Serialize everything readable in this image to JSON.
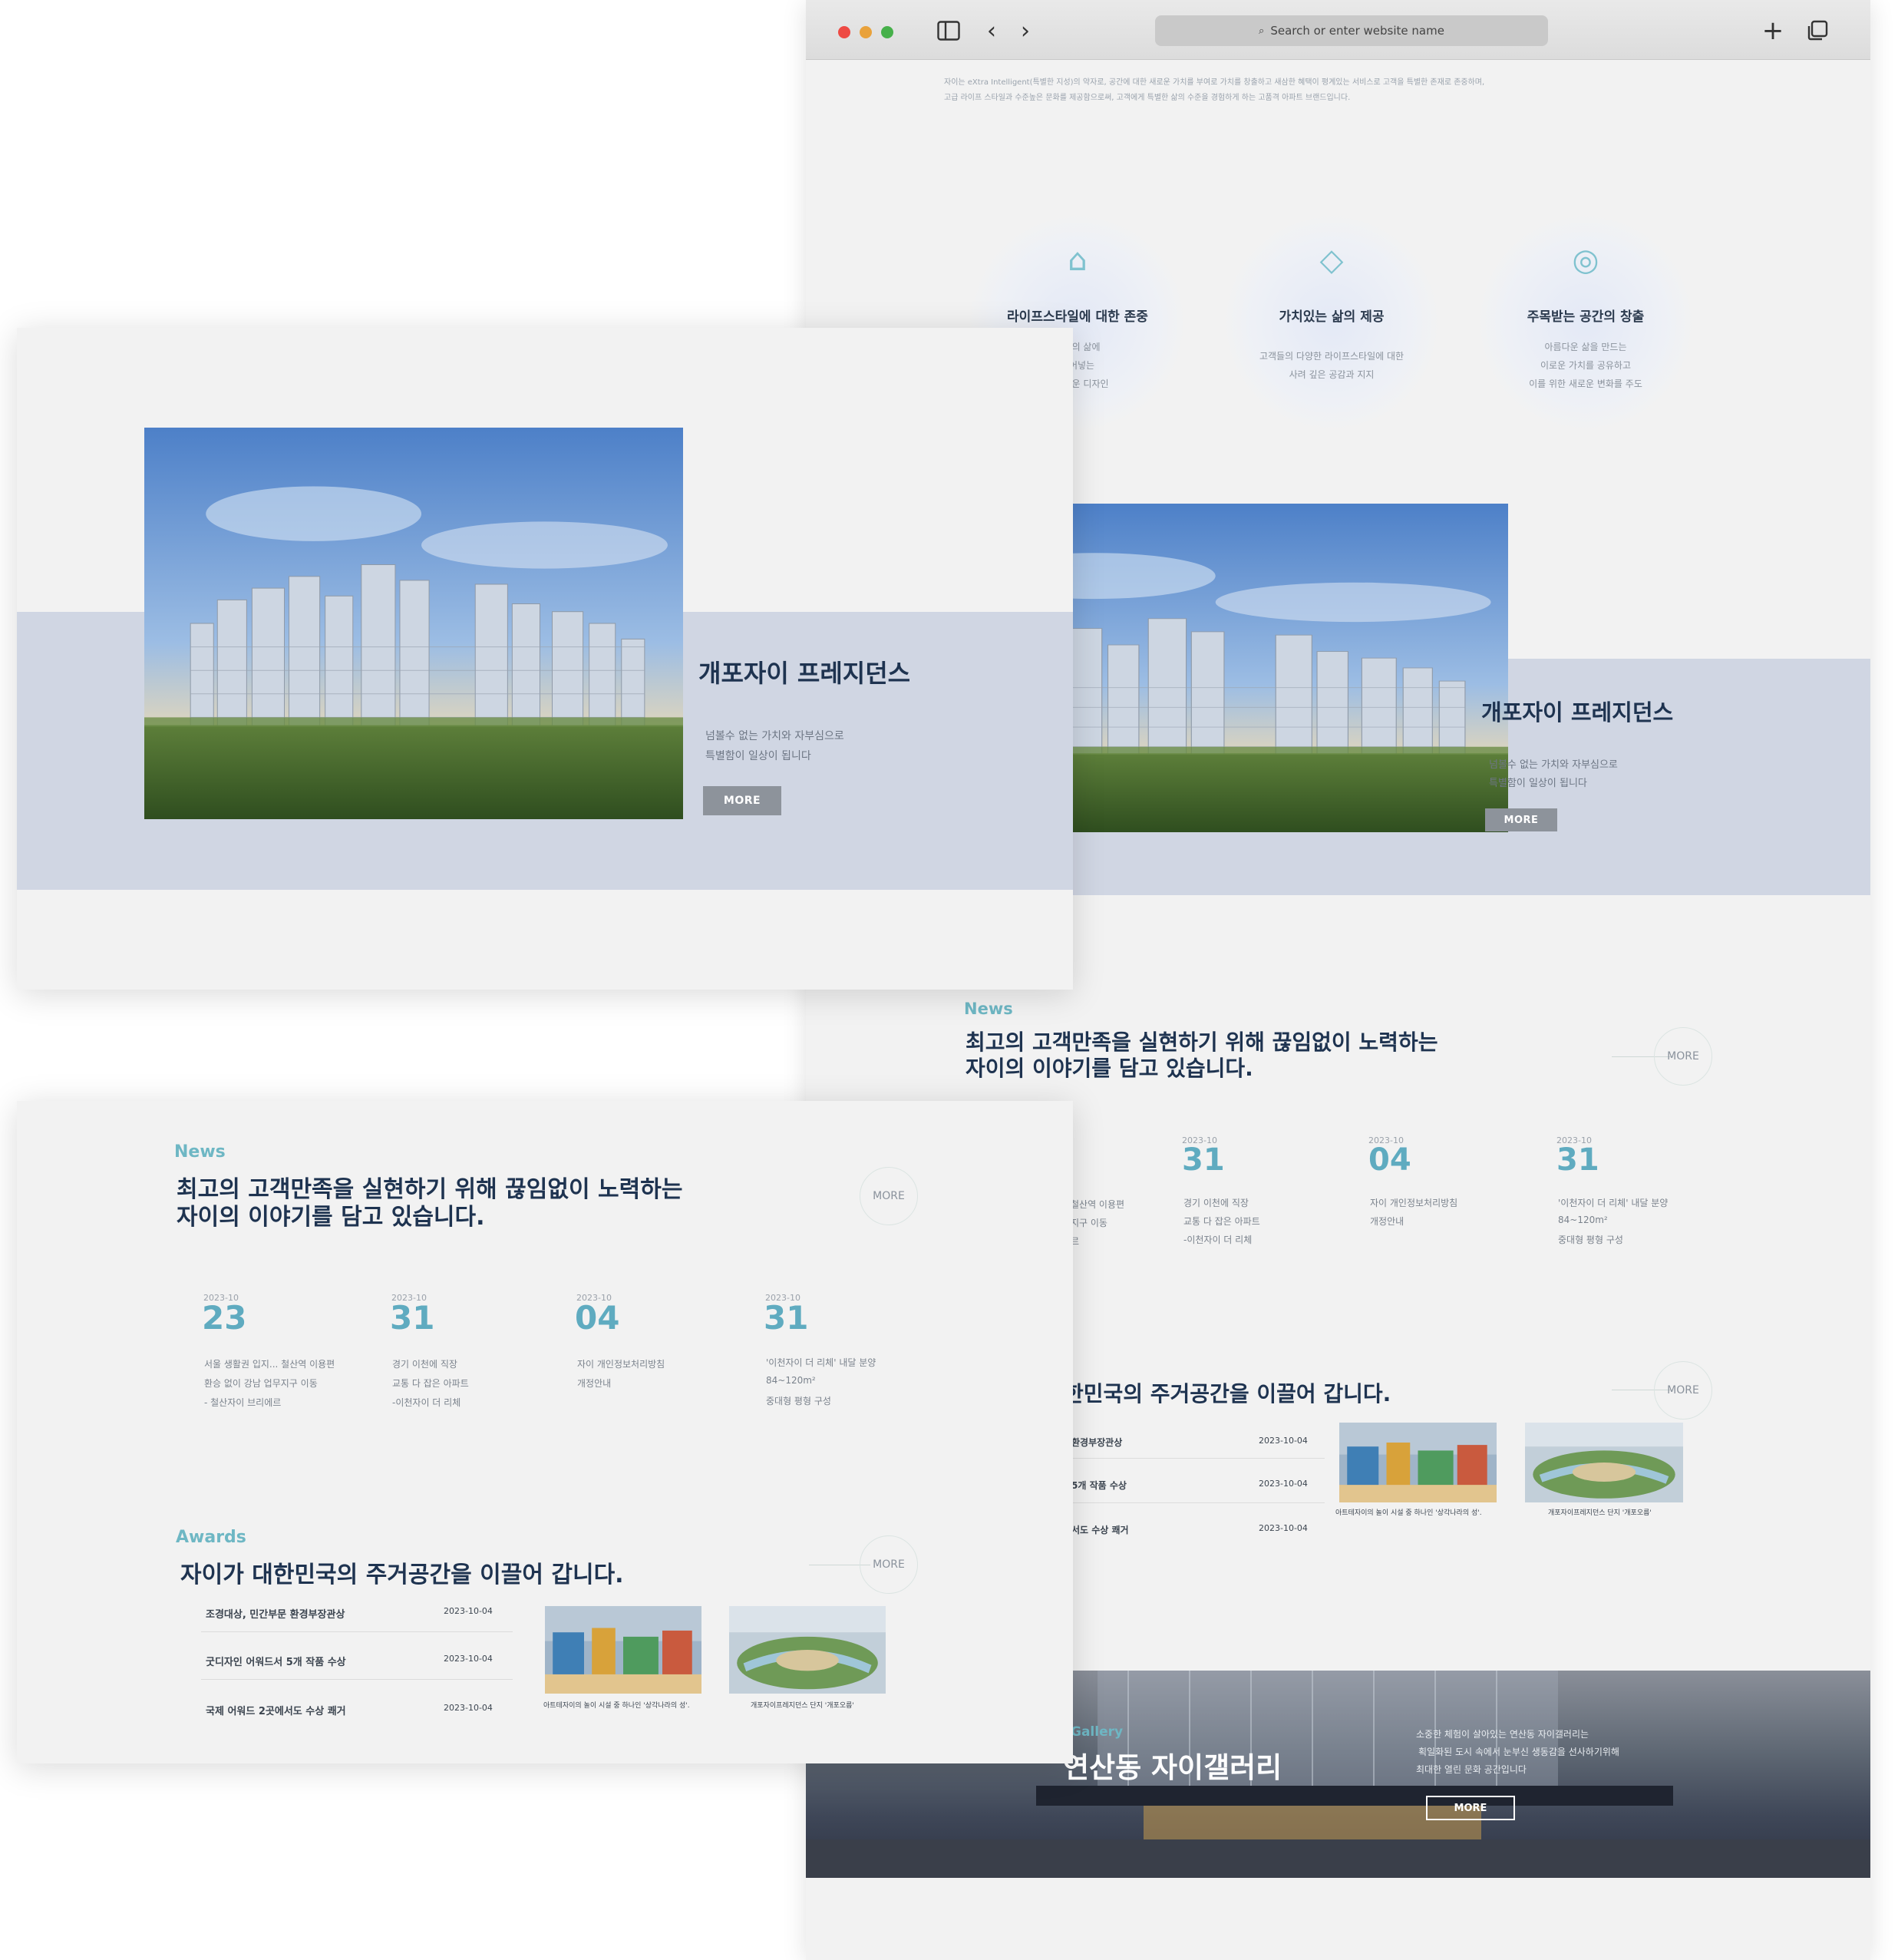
{
  "browser": {
    "url_placeholder": "Search or enter website name",
    "intro_line1": "자이는 eXtra Intelligent(특별한 지성)의 약자로, 공간에 대한 새로운 가치를 부여로 가치를 창출하고 새삼한 혜택이 평계있는 서비스로 고객을 특별한 존재로 존중하며,",
    "intro_line2": "고급 라이프 스타일과 수준높은 문화를 제공함으로써, 고객에게 특별한 삶의 수준을 경험하게 하는 고품격 아파트 브랜드입니다."
  },
  "features": [
    {
      "icon": "hand-house-icon",
      "glyph": "⌂",
      "title": "라이프스타일에 대한 존중",
      "desc": [
        "개인의 삶에",
        "불어넣는",
        "풍미로운 디자인"
      ]
    },
    {
      "icon": "diamond-icon",
      "glyph": "◇",
      "title": "가치있는 삶의 제공",
      "desc": [
        "고객들의 다양한 라이프스타일에 대한",
        "사려 깊은 공감과 지지"
      ]
    },
    {
      "icon": "power-circle-icon",
      "glyph": "◎",
      "title": "주목받는 공간의 창출",
      "desc": [
        "아름다운 삶을 만드는",
        "이로운 가치를 공유하고",
        "이를 위한 새로운 변화를 주도"
      ]
    }
  ],
  "hero": {
    "title": "개포자이 프레지던스",
    "desc1": "넘볼수 없는 가치와 자부심으로",
    "desc2": "특별함이 일상이 됩니다",
    "more": "MORE"
  },
  "news": {
    "label": "News",
    "head1": "최고의 고객만족을 실현하기 위해 끊임없이 노력하는",
    "head2": "자이의 이야기를 담고 있습니다.",
    "more": "MORE",
    "items": [
      {
        "ym": "2023-10",
        "day": "23",
        "lines": [
          "서울 생활권 입지... 철산역 이용편",
          "환승 없이 강남 업무지구 이동",
          " - 철산자이 브리에르"
        ]
      },
      {
        "ym": "2023-10",
        "day": "31",
        "lines": [
          "경기 이천에 직장",
          "교통 다 잡은 아파트",
          "-이천자이 더 리체"
        ]
      },
      {
        "ym": "2023-10",
        "day": "04",
        "lines": [
          "자이 개인정보처리방침",
          "개정안내"
        ]
      },
      {
        "ym": "2023-10",
        "day": "31",
        "lines": [
          "'이천자이 더 리체' 내달 분양",
          "84~120m²",
          "중대형 평형 구성"
        ]
      }
    ],
    "bg_fragments": [
      "철산역 이용편",
      "지구 이동",
      "르"
    ]
  },
  "awards": {
    "label": "Awards",
    "head": "자이가 대한민국의 주거공간을 이끌어 갑니다.",
    "head_partial": "한민국의 주거공간을 이끌어 갑니다.",
    "more": "MORE",
    "rows": [
      {
        "title": "조경대상, 민간부문 환경부장관상",
        "title_partial": "환경부장관상",
        "date": "2023-10-04"
      },
      {
        "title": "굿디자인 어워드서 5개 작품 수상",
        "title_partial": "5개 작품 수상",
        "date": "2023-10-04"
      },
      {
        "title": "국제 어워드 2곳에서도 수상 쾌거",
        "title_partial": "서도 수상 쾌거",
        "date": "2023-10-04"
      }
    ],
    "captions": [
      "아트테자이의 놀이 시설 중 하나인 '상각나라의 성'.",
      "개포자이프레지던스 단지 '개포오름'"
    ]
  },
  "gallery": {
    "label": "Gallery",
    "title": "연산동 자이갤러리",
    "desc1": "소중한 체험이 살아있는 연산동 자이갤러리는",
    "desc2": "획일화된 도시 속에서 눈부신 생동감을 선사하기위해",
    "desc3": "최대한 열린 문화 공간입니다",
    "more": "MORE"
  },
  "colors": {
    "accent": "#6eb7c4",
    "navy": "#1e3350",
    "band": "#d0d6e3",
    "button": "#8d939b"
  }
}
